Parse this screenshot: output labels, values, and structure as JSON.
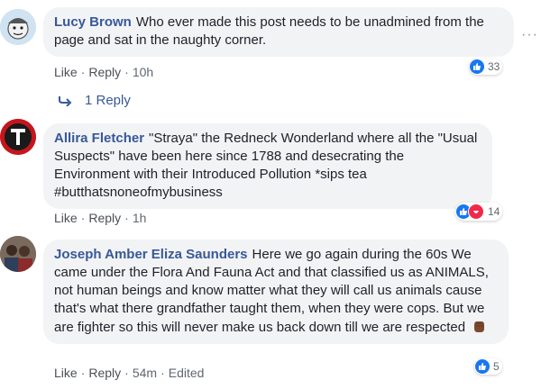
{
  "comments": [
    {
      "author": "Lucy Brown",
      "text": "Who ever made this post needs to be unadmined from the page and sat in the naughty corner.",
      "like": "Like",
      "reply": "Reply",
      "time": "10h",
      "reaction_count": "33",
      "reply_count": "1 Reply",
      "more": "···"
    },
    {
      "author": "Allira Fletcher",
      "text": "\"Straya\" the Redneck Wonderland where all the \"Usual Suspects\" have been here since 1788 and desecrating the Environment with their Introduced Pollution *sips tea #butthatsnoneofmybusiness",
      "like": "Like",
      "reply": "Reply",
      "time": "1h",
      "reaction_count": "14"
    },
    {
      "author": "Joseph Amber Eliza Saunders",
      "text": "Here we go again during the 60s We came under the Flora And Fauna Act and that classified us as ANIMALS, not human beings and know matter what they will call us animals cause that's what there grandfather taught them, when they were cops. But we are fighter so this will never make us back down till we are respected",
      "like": "Like",
      "reply": "Reply",
      "time": "54m",
      "edited": "Edited",
      "reaction_count": "5"
    }
  ],
  "colors": {
    "link": "#385898",
    "like_blue": "#1877f2",
    "haha_red": "#f02849",
    "bubble": "#f2f3f5"
  },
  "icons": [
    "like-icon",
    "haha-icon",
    "raised-fist-emoji",
    "reply-arrow-icon",
    "more-options-icon"
  ]
}
